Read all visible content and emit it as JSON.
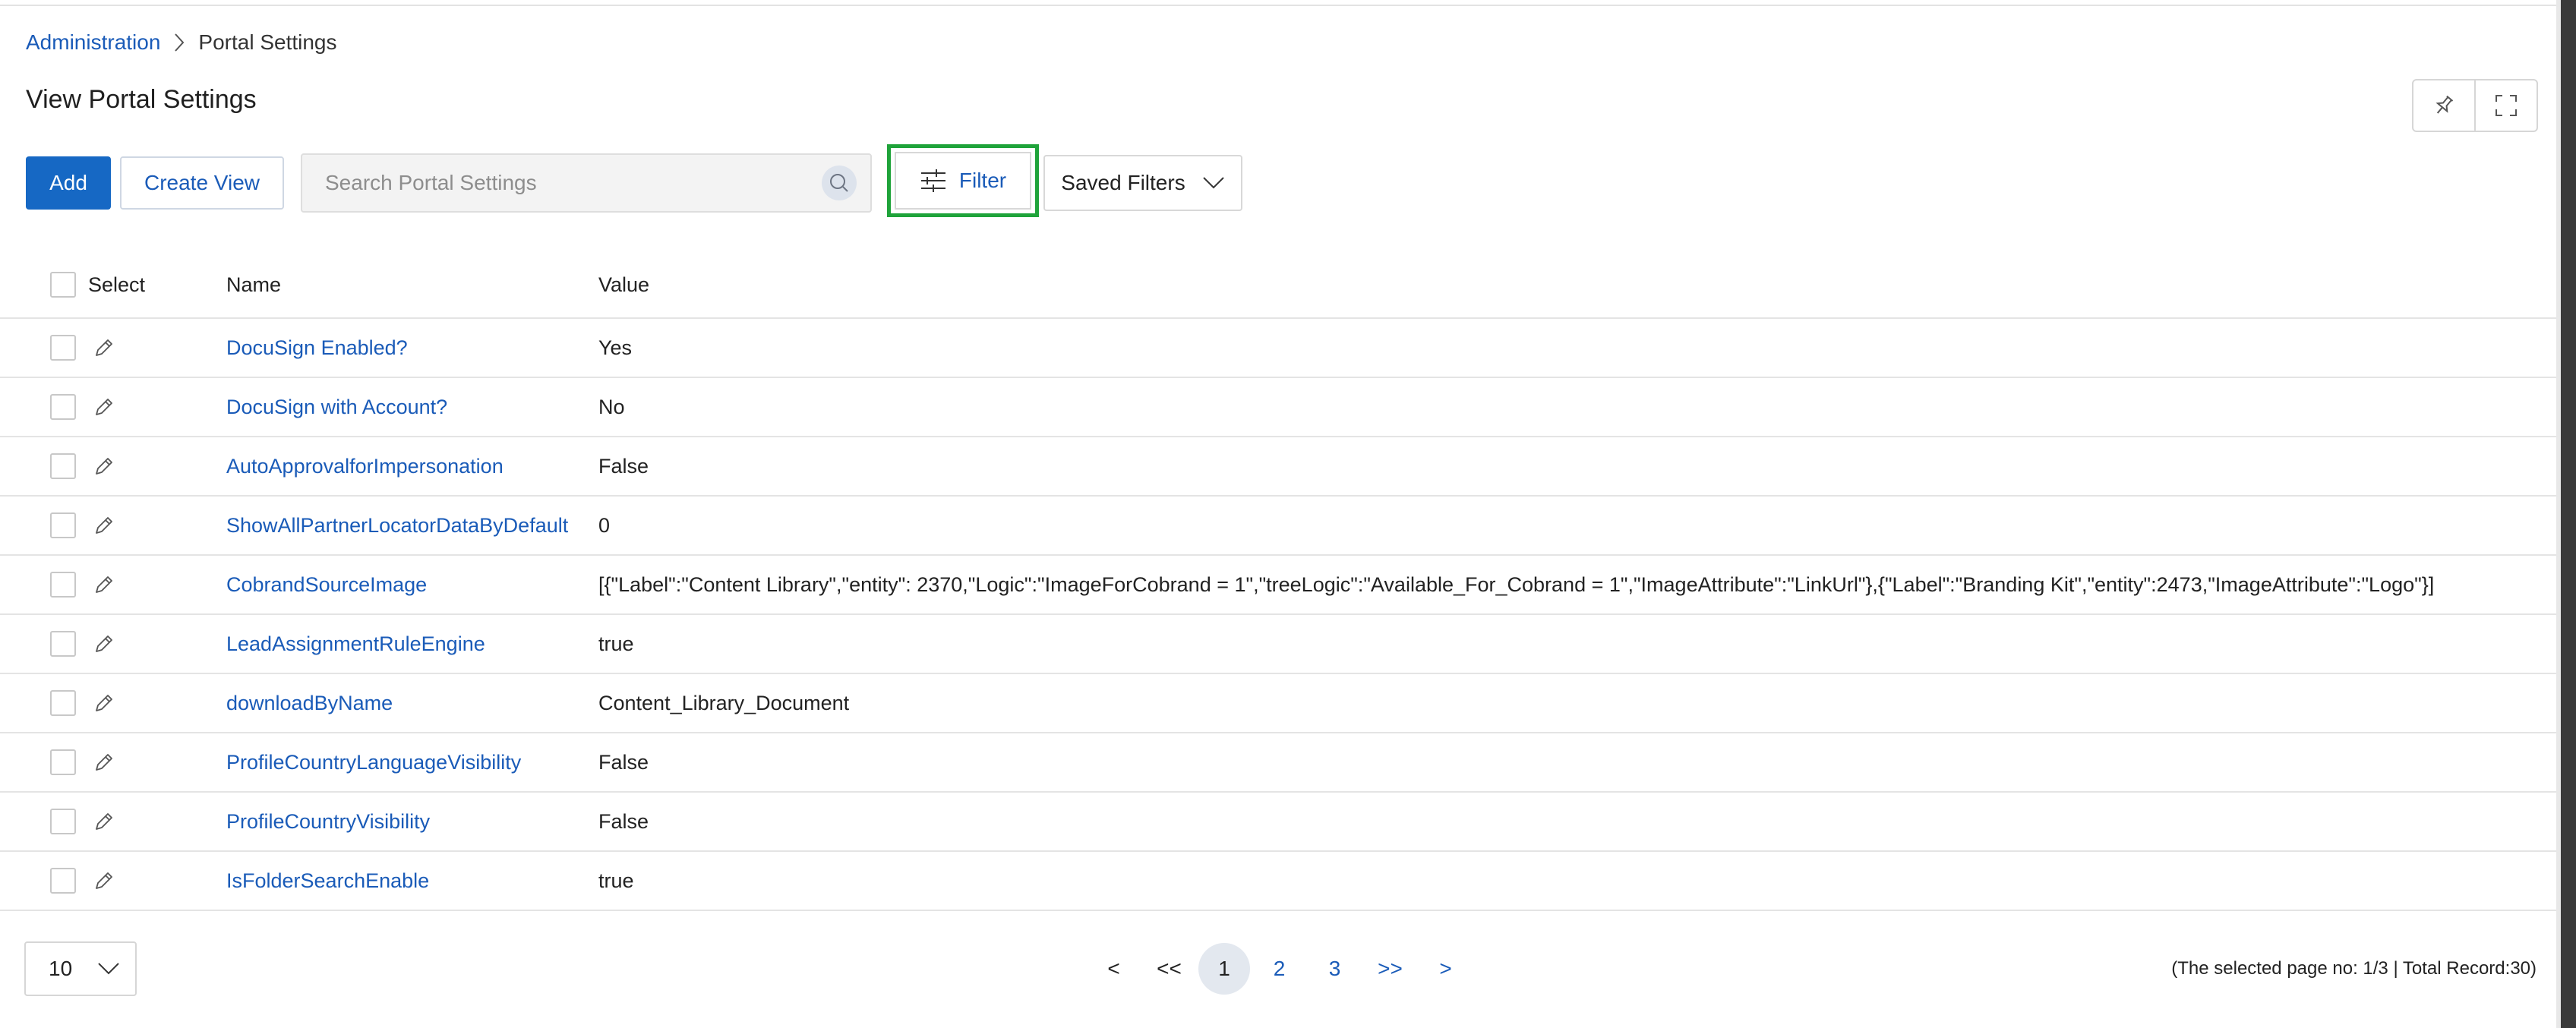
{
  "breadcrumb": {
    "parent": "Administration",
    "current": "Portal Settings"
  },
  "page_title": "View Portal Settings",
  "toolbar": {
    "add_label": "Add",
    "create_view_label": "Create View",
    "search_placeholder": "Search Portal Settings",
    "filter_label": "Filter",
    "saved_filters_label": "Saved Filters"
  },
  "table": {
    "columns": {
      "select": "Select",
      "name": "Name",
      "value": "Value"
    },
    "rows": [
      {
        "name": "DocuSign Enabled?",
        "value": "Yes"
      },
      {
        "name": "DocuSign with Account?",
        "value": "No"
      },
      {
        "name": "AutoApprovalforImpersonation",
        "value": "False"
      },
      {
        "name": "ShowAllPartnerLocatorDataByDefault",
        "value": "0"
      },
      {
        "name": "CobrandSourceImage",
        "value": "[{\"Label\":\"Content Library\",\"entity\": 2370,\"Logic\":\"ImageForCobrand = 1\",\"treeLogic\":\"Available_For_Cobrand = 1\",\"ImageAttribute\":\"LinkUrl\"},{\"Label\":\"Branding Kit\",\"entity\":2473,\"ImageAttribute\":\"Logo\"}]"
      },
      {
        "name": "LeadAssignmentRuleEngine",
        "value": "true"
      },
      {
        "name": "downloadByName",
        "value": "Content_Library_Document"
      },
      {
        "name": "ProfileCountryLanguageVisibility",
        "value": "False"
      },
      {
        "name": "ProfileCountryVisibility",
        "value": "False"
      },
      {
        "name": "IsFolderSearchEnable",
        "value": "true"
      }
    ]
  },
  "pagination": {
    "page_size": "10",
    "prev": "<",
    "first": "<<",
    "pages": [
      "1",
      "2",
      "3"
    ],
    "last": ">>",
    "next": ">",
    "current_page": "1",
    "info": "(The selected page no: 1/3 | Total Record:30)"
  },
  "colors": {
    "accent": "#1668c4",
    "link": "#1a5bb8",
    "highlight": "#1fa33a"
  },
  "icons": [
    "chevron-right-icon",
    "pin-icon",
    "fullscreen-icon",
    "search-icon",
    "filter-sliders-icon",
    "chevron-down-icon",
    "pencil-icon"
  ]
}
